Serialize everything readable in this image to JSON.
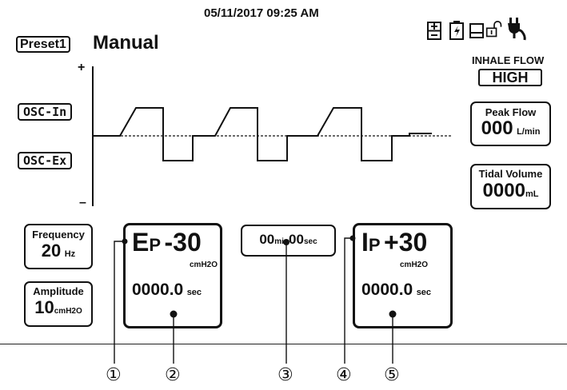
{
  "status_bar": {
    "datetime": "05/11/2017 09:25 AM",
    "icons": [
      "battery-level-icon",
      "battery-charging-icon",
      "storage-icon",
      "unlocked-icon",
      "ac-power-plug-icon"
    ]
  },
  "header": {
    "preset_label": "Preset1",
    "mode": "Manual"
  },
  "waveform": {
    "axis_top": "+",
    "axis_bottom": "–",
    "osc_in_label": "OSC-In",
    "osc_ex_label": "OSC-Ex"
  },
  "right_panel": {
    "inhale_flow_label": "INHALE FLOW",
    "inhale_flow_value": "HIGH",
    "peak_flow_label": "Peak Flow",
    "peak_flow_value": "000",
    "peak_flow_unit": "L/min",
    "tidal_volume_label": "Tidal Volume",
    "tidal_volume_value": "0000",
    "tidal_volume_unit": "mL"
  },
  "settings": {
    "frequency_label": "Frequency",
    "frequency_value": "20",
    "frequency_unit": "Hz",
    "amplitude_label": "Amplitude",
    "amplitude_value": "10",
    "amplitude_unit": "cmH2O"
  },
  "exhale_panel": {
    "prefix_big": "E",
    "prefix_small": "P",
    "value": "-30",
    "unit": "cmH2O",
    "time": "0000.0",
    "time_unit": "sec"
  },
  "timer": {
    "minutes": "00",
    "min_unit": "min",
    "seconds": "00",
    "sec_unit": "sec"
  },
  "inhale_panel": {
    "prefix_big": "I",
    "prefix_small": "P",
    "value": "+30",
    "unit": "cmH2O",
    "time": "0000.0",
    "time_unit": "sec"
  },
  "callouts": [
    "①",
    "②",
    "③",
    "④",
    "⑤"
  ]
}
